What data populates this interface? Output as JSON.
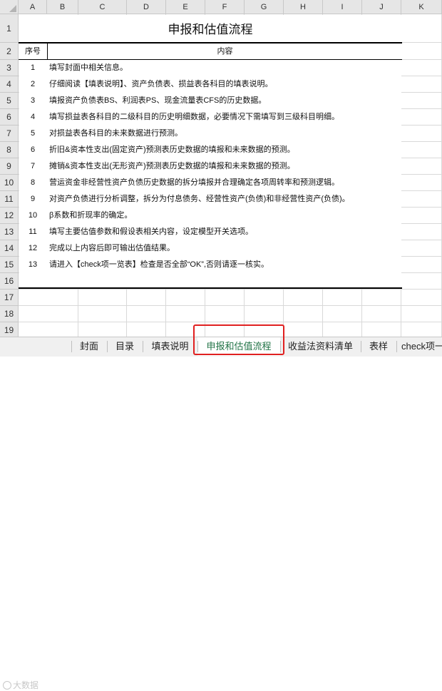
{
  "columns": [
    "A",
    "B",
    "C",
    "D",
    "E",
    "F",
    "G",
    "H",
    "I",
    "J",
    "K"
  ],
  "rows": [
    "1",
    "2",
    "3",
    "4",
    "5",
    "6",
    "7",
    "8",
    "9",
    "10",
    "11",
    "12",
    "13",
    "14",
    "15",
    "16",
    "17",
    "18",
    "19"
  ],
  "title": "申报和估值流程",
  "table_header": {
    "seq": "序号",
    "content": "内容"
  },
  "items": [
    {
      "no": "1",
      "text": "填写封面中相关信息。"
    },
    {
      "no": "2",
      "text": "仔细阅读【填表说明】、资产负债表、损益表各科目的填表说明。"
    },
    {
      "no": "3",
      "text": "填报资产负债表BS、利润表PS、现金流量表CFS的历史数据。"
    },
    {
      "no": "4",
      "text": "填写损益表各科目的二级科目的历史明细数据，必要情况下需填写到三级科目明细。"
    },
    {
      "no": "5",
      "text": "对损益表各科目的未来数据进行预测。"
    },
    {
      "no": "6",
      "text": "折旧&资本性支出(固定资产)预测表历史数据的填报和未来数据的预测。"
    },
    {
      "no": "7",
      "text": "摊销&资本性支出(无形资产)预测表历史数据的填报和未来数据的预测。"
    },
    {
      "no": "8",
      "text": "营运资金非经营性资产负债历史数据的拆分填报并合理确定各项周转率和预测逻辑。"
    },
    {
      "no": "9",
      "text": "对资产负债进行分析调整，拆分为付息债务、经营性资产(负债)和非经营性资产(负债)。"
    },
    {
      "no": "10",
      "text": "β系数和折现率的确定。"
    },
    {
      "no": "11",
      "text": "填写主要估值参数和假设表相关内容，设定模型开关选项。"
    },
    {
      "no": "12",
      "text": "完成以上内容后即可输出估值结果。"
    },
    {
      "no": "13",
      "text": "请进入【check项一览表】检查是否全部“OK”,否则请逐一核实。"
    }
  ],
  "tabs": [
    {
      "label": "封面"
    },
    {
      "label": "目录"
    },
    {
      "label": "填表说明"
    },
    {
      "label": "申报和估值流程",
      "active": true
    },
    {
      "label": "收益法资料清单"
    },
    {
      "label": "表样"
    },
    {
      "label": "check项一"
    }
  ],
  "watermark": "大数据",
  "colors": {
    "active_tab_text": "#217346",
    "highlight_border": "#e02020",
    "header_bg": "#e6e6e6"
  }
}
